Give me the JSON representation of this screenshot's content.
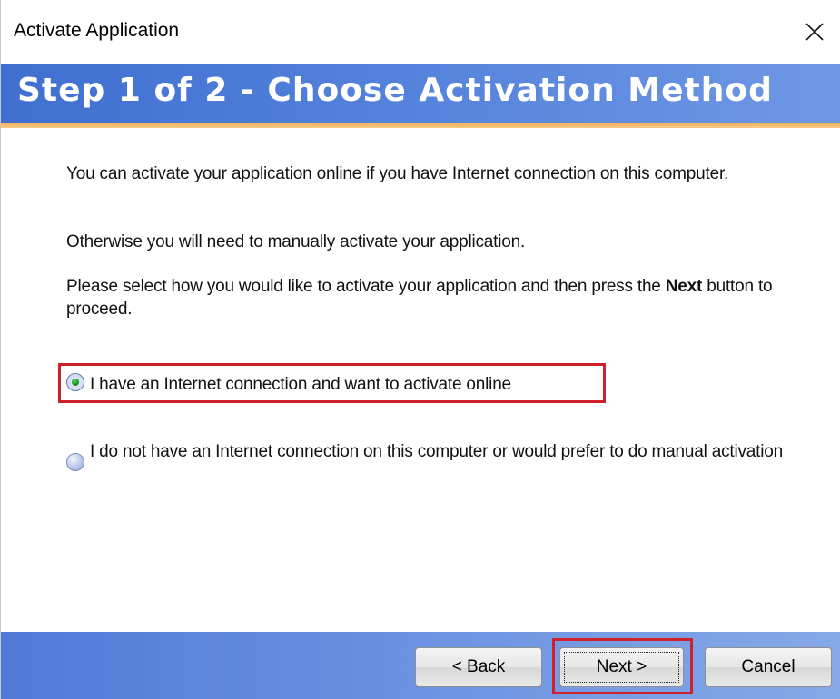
{
  "window": {
    "title": "Activate Application",
    "close_icon": "close-icon"
  },
  "banner": {
    "heading": "Step 1 of 2 - Choose Activation Method",
    "colors": {
      "banner": "#4a7ad6",
      "accent_line": "#f5b35a"
    }
  },
  "content": {
    "para1": "You can activate your application online if you have Internet connection on this computer.",
    "para2": "Otherwise you will need to manually activate your application.",
    "para3_before": "Please select how you would like to activate your application and then press the ",
    "para3_bold": "Next",
    "para3_after": " button to proceed.",
    "options": [
      {
        "label": "I have an Internet connection and want to activate online",
        "checked": true
      },
      {
        "label": "I do not have an Internet connection on this computer or would prefer to do manual activation",
        "checked": false
      }
    ]
  },
  "footer": {
    "back_label": "< Back",
    "next_label": "Next >",
    "cancel_label": "Cancel"
  },
  "annotations": {
    "highlight_color": "#d0202a"
  }
}
